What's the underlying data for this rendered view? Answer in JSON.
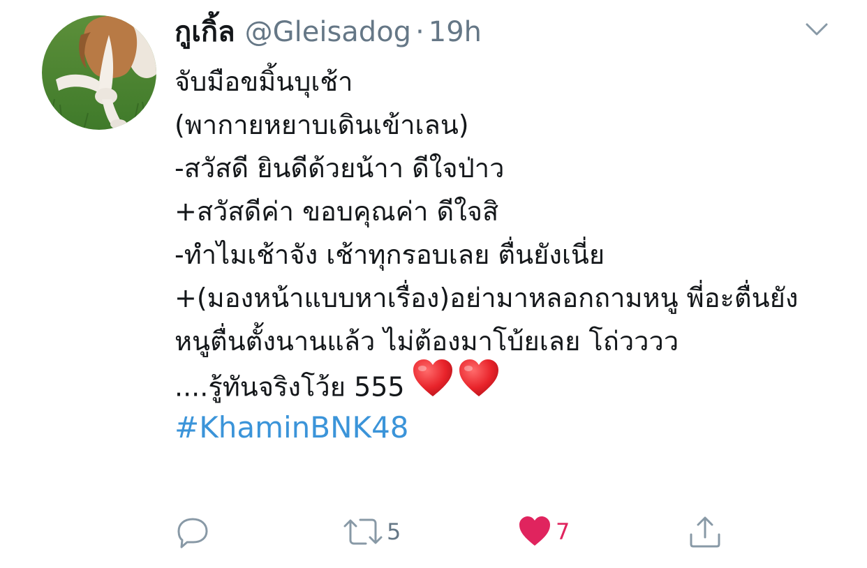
{
  "tweet": {
    "display_name": "กูเกิ้ล",
    "handle": "@Gleisadog",
    "separator": "·",
    "time": "19h",
    "lines": [
      "จับมือขมิ้นบุเช้า",
      "(พากายหยาบเดินเข้าเลน)",
      "-สวัสดี ยินดีด้วยน้าา ดีใจป่าว",
      "+สวัสดีค่า ขอบคุณค่า ดีใจสิ",
      "-ทำไมเช้าจัง เช้าทุกรอบเลย ตื่นยังเนี่ย",
      "+(มองหน้าแบบหาเรื่อง)อย่ามาหลอกถามหนู พี่อะตื่นยัง หนูตื่นตั้งนานแล้ว ไม่ต้องมาโบ้ยเลย โถ่วววว",
      "....รู้ทันจริงโว้ย 555"
    ],
    "hashtag": "#KhaminBNK48",
    "retweet_count": "5",
    "like_count": "7"
  },
  "colors": {
    "text": "#14171a",
    "secondary": "#657786",
    "link": "#3b94d9",
    "like": "#e0245e",
    "icon": "#8899a6"
  },
  "icons": {
    "caret": "chevron-down-icon",
    "reply": "reply-icon",
    "retweet": "retweet-icon",
    "like": "heart-icon",
    "share": "share-icon",
    "emoji": "red-heart-emoji"
  }
}
